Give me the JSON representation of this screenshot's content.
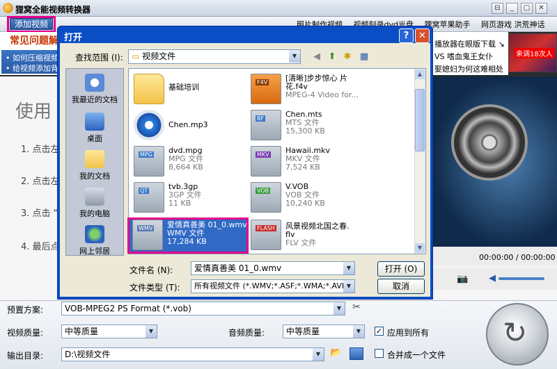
{
  "app": {
    "title": "狸窝全能视频转换器",
    "window_buttons": [
      "⊟",
      "_",
      "□",
      "✕"
    ],
    "add_video_label": "添加视频",
    "top_links": [
      "照片制作视频",
      "视频刻录dvd光盘",
      "狸窝苹果助手",
      "网页游戏 洪荒神话"
    ]
  },
  "faq": {
    "title": "常见问题解",
    "items": [
      "• 如何压缩视频",
      "• 给视频添加背"
    ]
  },
  "ads": {
    "lines": [
      "播放器在眼版下载 ↘",
      "VS 嗜血鬼王女仆",
      "娶媳妇为何这难相处"
    ],
    "badge": "来调18次人"
  },
  "guide": {
    "title": "使用",
    "steps": [
      "1. 点击左",
      "2. 点击左",
      "3. 点击 \"",
      "4. 最后点击"
    ]
  },
  "player": {
    "time": "00:00:00 / 00:00:00"
  },
  "bottom": {
    "preset_label": "预置方案:",
    "preset_value": "VOB-MPEG2 PS Format (*.vob)",
    "video_quality_label": "视频质量:",
    "video_quality_value": "中等质量",
    "audio_quality_label": "音频质量:",
    "audio_quality_value": "中等质量",
    "apply_all_label": "应用到所有",
    "output_label": "输出目录:",
    "output_value": "D:\\视频文件",
    "merge_label": "合并成一个文件"
  },
  "dialog": {
    "title": "打开",
    "help": "?",
    "close": "✕",
    "look_in_label": "查找范围 (I):",
    "look_in_value": "视频文件",
    "places": [
      "我最近的文档",
      "桌面",
      "我的文档",
      "我的电脑",
      "网上邻居"
    ],
    "files": [
      {
        "name": "基础培训",
        "line2": "",
        "line3": "",
        "tag": ""
      },
      {
        "name": "[清晰]步步惊心 片",
        "line2": "花.f4v",
        "line3": "MPEG-4 Video for...",
        "tag": "F4V"
      },
      {
        "name": "Chen.mp3",
        "line2": "",
        "line3": "",
        "tag": ""
      },
      {
        "name": "Chen.mts",
        "line2": "MTS 文件",
        "line3": "15,300 KB",
        "tag": "BF"
      },
      {
        "name": "dvd.mpg",
        "line2": "MPG 文件",
        "line3": "8,664 KB",
        "tag": "MPG"
      },
      {
        "name": "Hawaii.mkv",
        "line2": "MKV 文件",
        "line3": "7,524 KB",
        "tag": "MKV"
      },
      {
        "name": "tvb.3gp",
        "line2": "3GP 文件",
        "line3": "11 KB",
        "tag": "QT"
      },
      {
        "name": "V.VOB",
        "line2": "VOB 文件",
        "line3": "10,240 KB",
        "tag": "VOB"
      },
      {
        "name": "爱情真善美 01_0.wmv",
        "line2": "WMV 文件",
        "line3": "17,284 KB",
        "tag": "WMV"
      },
      {
        "name": "风景视频北国之春.",
        "line2": "flv",
        "line3": "FLV 文件",
        "tag": "FLASH"
      }
    ],
    "filename_label": "文件名 (N):",
    "filename_value": "爱情真善美 01_0.wmv",
    "filetype_label": "文件类型 (T):",
    "filetype_value": "所有视频文件 (*.WMV;*.ASF;*.WMA;*.AVI;",
    "open_label": "打开 (O)",
    "cancel_label": "取消"
  }
}
